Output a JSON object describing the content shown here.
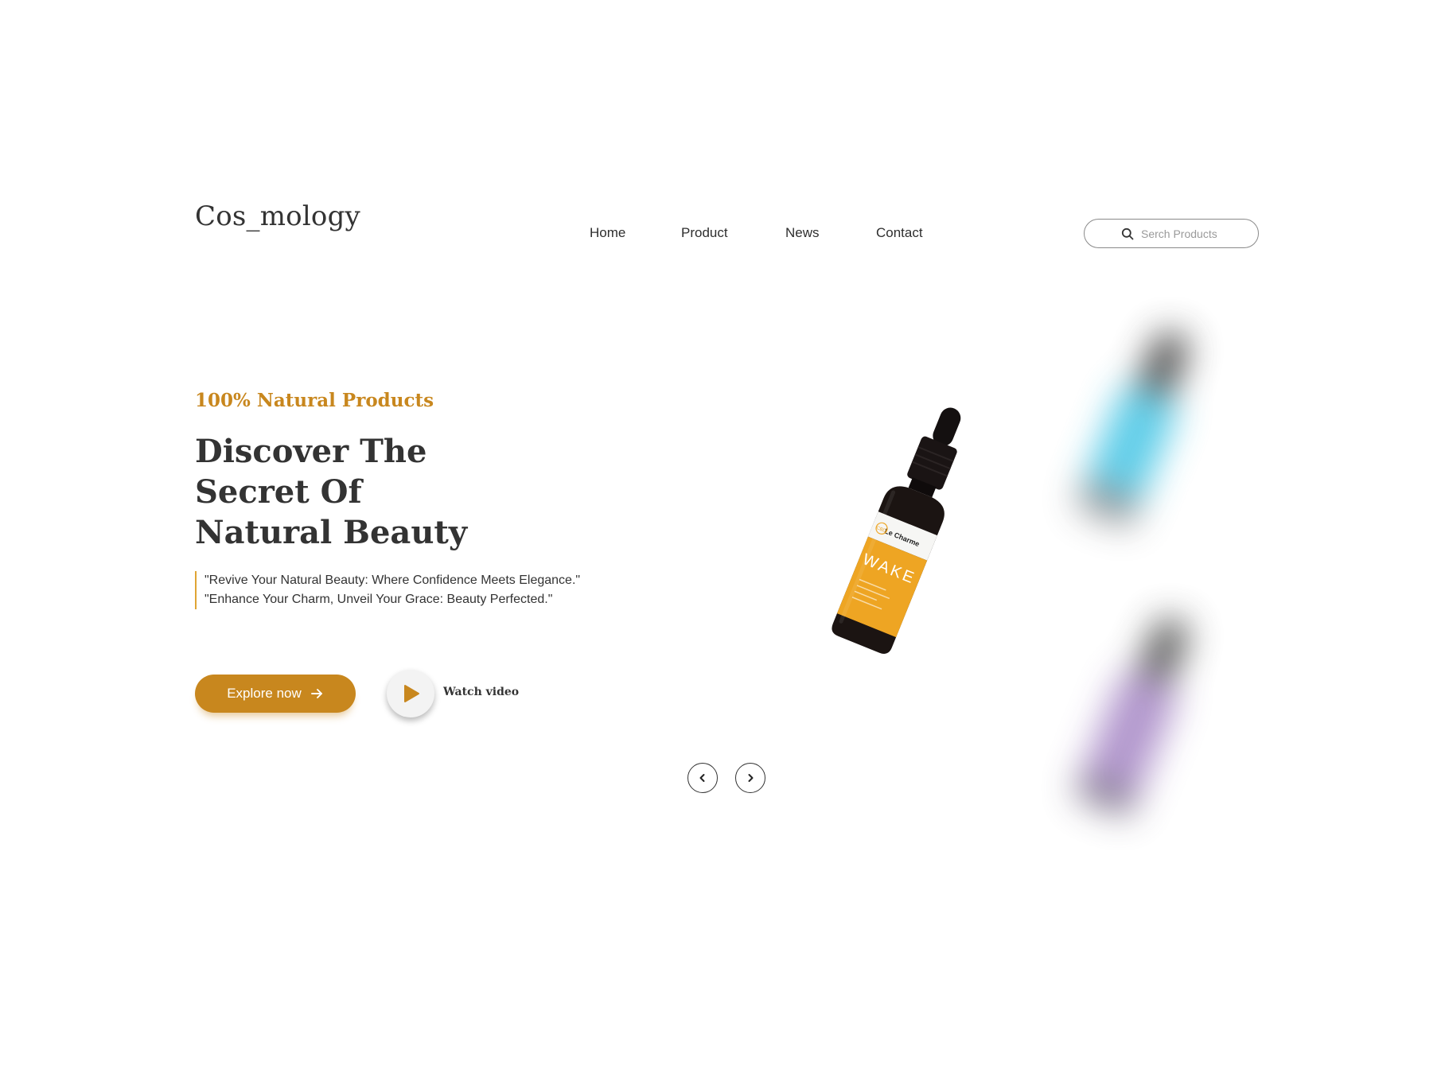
{
  "brand": {
    "logo": "Cos_mology"
  },
  "nav": {
    "items": [
      {
        "label": "Home"
      },
      {
        "label": "Product"
      },
      {
        "label": "News"
      },
      {
        "label": "Contact"
      }
    ]
  },
  "search": {
    "placeholder": "Serch Products",
    "value": ""
  },
  "hero": {
    "eyebrow": "100% Natural Products",
    "headline": [
      "Discover The",
      "Secret Of",
      "Natural Beauty"
    ],
    "quotes": [
      "\"Revive Your Natural Beauty: Where Confidence Meets Elegance.\"",
      "\"Enhance Your Charm, Unveil Your Grace: Beauty Perfected.\""
    ],
    "explore_label": "Explore now",
    "watch_label": "Watch video"
  },
  "product": {
    "label_brand": "Le Charme",
    "label_name": "WAKE",
    "badge": "CBD"
  },
  "colors": {
    "accent": "#c8871e",
    "text": "#333333",
    "quote_bar": "#e0a534",
    "bottle_label": "#eea523",
    "bottle_glass": "#1b1412",
    "blur_blue": "#4fc8e6",
    "blur_purple": "#a98bc7"
  },
  "icons": {
    "search": "search-icon",
    "explore_arrow": "arrow-right-icon",
    "play": "play-icon",
    "prev": "chevron-left-icon",
    "next": "chevron-right-icon"
  }
}
